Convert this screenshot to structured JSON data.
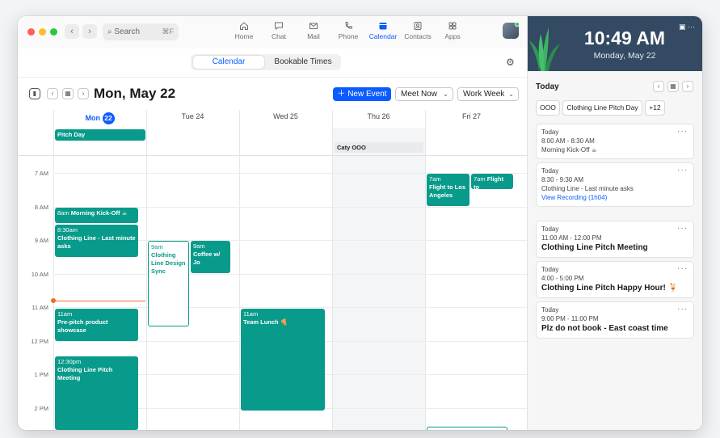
{
  "window": {
    "search": {
      "label": "Search",
      "shortcut": "⌘F"
    },
    "tabs": [
      {
        "label": "Home",
        "icon": "home-icon"
      },
      {
        "label": "Chat",
        "icon": "chat-icon"
      },
      {
        "label": "Mail",
        "icon": "mail-icon"
      },
      {
        "label": "Phone",
        "icon": "phone-icon"
      },
      {
        "label": "Calendar",
        "icon": "calendar-icon",
        "active": true
      },
      {
        "label": "Contacts",
        "icon": "contacts-icon"
      },
      {
        "label": "Apps",
        "icon": "apps-icon"
      }
    ],
    "accent": "#0b5cff"
  },
  "subheader": {
    "segments": [
      "Calendar",
      "Bookable Times"
    ]
  },
  "toolbar": {
    "date_title": "Mon, May 22",
    "new_event": "New Event",
    "meet_now": "Meet Now",
    "view": "Work Week"
  },
  "grid": {
    "days": [
      {
        "name": "Mon",
        "num": "22",
        "today": true
      },
      {
        "name": "Tue",
        "num": "24"
      },
      {
        "name": "Wed",
        "num": "25"
      },
      {
        "name": "Thu",
        "num": "26"
      },
      {
        "name": "Fri",
        "num": "27"
      }
    ],
    "times": [
      "7 AM",
      "8 AM",
      "9 AM",
      "10 AM",
      "11 AM",
      "12 PM",
      "1 PM",
      "2 PM"
    ],
    "allday": {
      "pitch_day": "Pitch Day",
      "caty_ooo": "Caty OOO"
    },
    "events": {
      "kickoff_time": "8am",
      "kickoff_title": "Morning Kick-Off ☕",
      "clothing_time": "8:30am",
      "clothing_title": "Clothing Line - Last minute asks",
      "prepitch_time": "11am",
      "prepitch_title": "Pre-pitch product showcase",
      "pitchmtg_time": "12:30pm",
      "pitchmtg_title": "Clothing Line Pitch Meeting",
      "design_time": "9am",
      "design_title": "Clothing Line Design Sync",
      "coffee_time": "9am",
      "coffee_title": "Coffee w/ Jo",
      "lunch_time": "11am",
      "lunch_title": "Team Lunch 🍕",
      "flight1_time": "7am",
      "flight1_title": "Flight to Los Angeles",
      "flight2_time": "7am",
      "flight2_title": "Flight to"
    },
    "event_color": "#089a8a",
    "now_color": "#f06a2b"
  },
  "panel": {
    "clock_time": "10:49 AM",
    "clock_date": "Monday, May 22",
    "heading": "Today",
    "chips": [
      "OOO",
      "Clothing Line Pitch Day",
      "+12"
    ],
    "cards": [
      {
        "day": "Today",
        "time": "8:00 AM - 8:30 AM",
        "title": "Morning Kick-Off ☕"
      },
      {
        "day": "Today",
        "time": "8:30 - 9:30 AM",
        "title": "Clothing Line - Last minute asks",
        "link": "View Recording (1h04)"
      },
      {
        "day": "Today",
        "time": "11:00 AM - 12:00 PM",
        "title": "Clothing Line Pitch Meeting"
      },
      {
        "day": "Today",
        "time": "4:00 - 5:00 PM",
        "title": "Clothing Line Pitch Happy Hour! 🍹"
      },
      {
        "day": "Today",
        "time": "9:00 PM - 11:00 PM",
        "title": "Plz do not book - East coast time"
      }
    ]
  }
}
